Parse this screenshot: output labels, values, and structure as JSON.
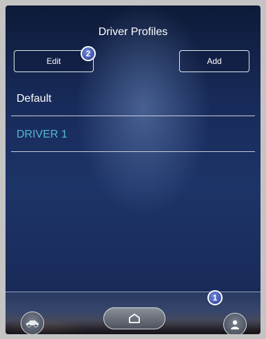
{
  "screen": {
    "title": "Driver Profiles"
  },
  "buttons": {
    "edit_label": "Edit",
    "add_label": "Add"
  },
  "profiles": [
    {
      "label": "Default",
      "color": "#ffffff"
    },
    {
      "label": "DRIVER 1",
      "color": "#53b8d6"
    }
  ],
  "callouts": {
    "edit_marker": "2",
    "profile_marker": "1"
  },
  "dock": {
    "icons": [
      "car-icon",
      "home-icon",
      "person-icon"
    ]
  }
}
